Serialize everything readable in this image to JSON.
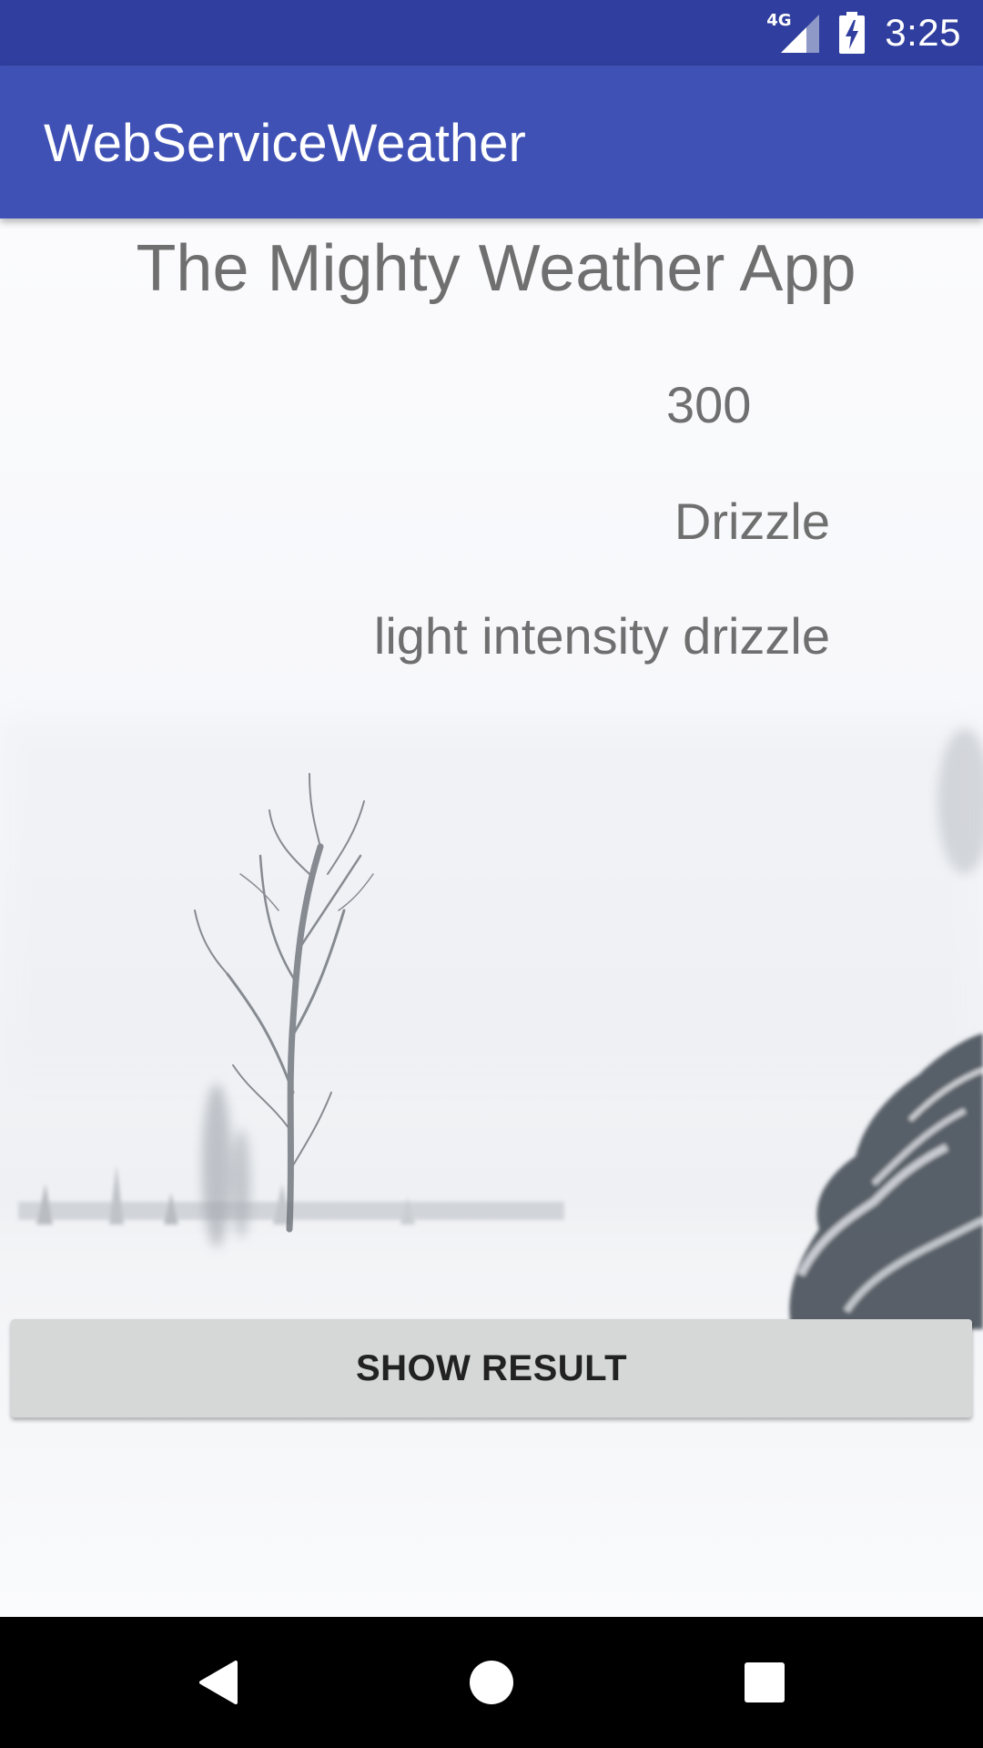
{
  "status_bar": {
    "network": "4G",
    "time": "3:25",
    "icons": [
      "signal-icon",
      "battery-charging-icon"
    ]
  },
  "app_bar": {
    "title": "WebServiceWeather"
  },
  "main": {
    "heading": "The Mighty Weather App",
    "weather_id": "300",
    "weather_main": "Drizzle",
    "weather_description": "light intensity drizzle",
    "show_result_button": "SHOW RESULT",
    "background": "snowy-landscape-image"
  },
  "nav_bar": {
    "icons": [
      "back-icon",
      "home-icon",
      "recents-icon"
    ]
  },
  "colors": {
    "status_bar": "#303f9f",
    "app_bar": "#3f51b5",
    "text_gray": "#6f6f6f",
    "button_bg": "#d6d7d7"
  }
}
